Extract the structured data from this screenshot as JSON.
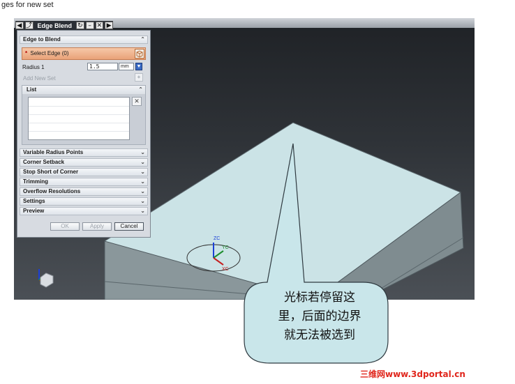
{
  "window": {
    "title_fragment": "ges for new set",
    "dialog_title": "Edge Blend"
  },
  "dialog": {
    "groups": {
      "edge_to_blend": "Edge to Blend",
      "list": "List"
    },
    "select_edge": {
      "required_mark": "*",
      "label": "Select Edge (0)"
    },
    "radius": {
      "label": "Radius 1",
      "value": "1.5",
      "unit": "mm"
    },
    "add_new_set": "Add New Set",
    "collapsed_groups": [
      "Variable Radius Points",
      "Corner Setback",
      "Stop Short of Corner",
      "Trimming",
      "Overflow Resolutions",
      "Settings",
      "Preview"
    ],
    "buttons": {
      "ok": "OK",
      "apply": "Apply",
      "cancel": "Cancel"
    }
  },
  "viewport": {
    "csys_labels": {
      "zc": "ZC",
      "yc": "YC",
      "xc": "XC"
    }
  },
  "callout": {
    "text": "光标若停留这\n里，后面的边界\n就无法被选到"
  },
  "watermark": "三维网www.3dportal.cn",
  "colors": {
    "model_top": "#cbe3e6",
    "model_side": "#7f8c90",
    "callout_fill": "#c9e6ea",
    "select_highlight": "#eea87f",
    "watermark": "#e0261c"
  },
  "icons": [
    "back-icon",
    "pin-icon",
    "reset-icon",
    "minimize-icon",
    "close-icon",
    "forward-icon",
    "cube-icon",
    "dropdown-arrow-icon",
    "add-set-icon",
    "delete-icon",
    "chevron-up-icon",
    "chevron-down-icon",
    "wcs-cube-icon"
  ]
}
